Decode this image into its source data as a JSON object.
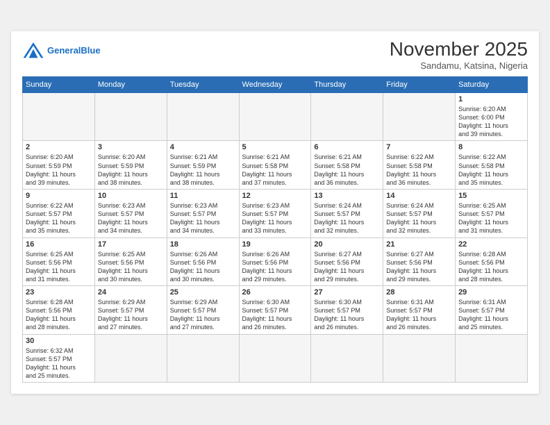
{
  "header": {
    "logo_general": "General",
    "logo_blue": "Blue",
    "month": "November 2025",
    "location": "Sandamu, Katsina, Nigeria"
  },
  "weekdays": [
    "Sunday",
    "Monday",
    "Tuesday",
    "Wednesday",
    "Thursday",
    "Friday",
    "Saturday"
  ],
  "weeks": [
    [
      {
        "day": "",
        "info": ""
      },
      {
        "day": "",
        "info": ""
      },
      {
        "day": "",
        "info": ""
      },
      {
        "day": "",
        "info": ""
      },
      {
        "day": "",
        "info": ""
      },
      {
        "day": "",
        "info": ""
      },
      {
        "day": "1",
        "info": "Sunrise: 6:20 AM\nSunset: 6:00 PM\nDaylight: 11 hours\nand 39 minutes."
      }
    ],
    [
      {
        "day": "2",
        "info": "Sunrise: 6:20 AM\nSunset: 5:59 PM\nDaylight: 11 hours\nand 39 minutes."
      },
      {
        "day": "3",
        "info": "Sunrise: 6:20 AM\nSunset: 5:59 PM\nDaylight: 11 hours\nand 38 minutes."
      },
      {
        "day": "4",
        "info": "Sunrise: 6:21 AM\nSunset: 5:59 PM\nDaylight: 11 hours\nand 38 minutes."
      },
      {
        "day": "5",
        "info": "Sunrise: 6:21 AM\nSunset: 5:58 PM\nDaylight: 11 hours\nand 37 minutes."
      },
      {
        "day": "6",
        "info": "Sunrise: 6:21 AM\nSunset: 5:58 PM\nDaylight: 11 hours\nand 36 minutes."
      },
      {
        "day": "7",
        "info": "Sunrise: 6:22 AM\nSunset: 5:58 PM\nDaylight: 11 hours\nand 36 minutes."
      },
      {
        "day": "8",
        "info": "Sunrise: 6:22 AM\nSunset: 5:58 PM\nDaylight: 11 hours\nand 35 minutes."
      }
    ],
    [
      {
        "day": "9",
        "info": "Sunrise: 6:22 AM\nSunset: 5:57 PM\nDaylight: 11 hours\nand 35 minutes."
      },
      {
        "day": "10",
        "info": "Sunrise: 6:23 AM\nSunset: 5:57 PM\nDaylight: 11 hours\nand 34 minutes."
      },
      {
        "day": "11",
        "info": "Sunrise: 6:23 AM\nSunset: 5:57 PM\nDaylight: 11 hours\nand 34 minutes."
      },
      {
        "day": "12",
        "info": "Sunrise: 6:23 AM\nSunset: 5:57 PM\nDaylight: 11 hours\nand 33 minutes."
      },
      {
        "day": "13",
        "info": "Sunrise: 6:24 AM\nSunset: 5:57 PM\nDaylight: 11 hours\nand 32 minutes."
      },
      {
        "day": "14",
        "info": "Sunrise: 6:24 AM\nSunset: 5:57 PM\nDaylight: 11 hours\nand 32 minutes."
      },
      {
        "day": "15",
        "info": "Sunrise: 6:25 AM\nSunset: 5:57 PM\nDaylight: 11 hours\nand 31 minutes."
      }
    ],
    [
      {
        "day": "16",
        "info": "Sunrise: 6:25 AM\nSunset: 5:56 PM\nDaylight: 11 hours\nand 31 minutes."
      },
      {
        "day": "17",
        "info": "Sunrise: 6:25 AM\nSunset: 5:56 PM\nDaylight: 11 hours\nand 30 minutes."
      },
      {
        "day": "18",
        "info": "Sunrise: 6:26 AM\nSunset: 5:56 PM\nDaylight: 11 hours\nand 30 minutes."
      },
      {
        "day": "19",
        "info": "Sunrise: 6:26 AM\nSunset: 5:56 PM\nDaylight: 11 hours\nand 29 minutes."
      },
      {
        "day": "20",
        "info": "Sunrise: 6:27 AM\nSunset: 5:56 PM\nDaylight: 11 hours\nand 29 minutes."
      },
      {
        "day": "21",
        "info": "Sunrise: 6:27 AM\nSunset: 5:56 PM\nDaylight: 11 hours\nand 29 minutes."
      },
      {
        "day": "22",
        "info": "Sunrise: 6:28 AM\nSunset: 5:56 PM\nDaylight: 11 hours\nand 28 minutes."
      }
    ],
    [
      {
        "day": "23",
        "info": "Sunrise: 6:28 AM\nSunset: 5:56 PM\nDaylight: 11 hours\nand 28 minutes."
      },
      {
        "day": "24",
        "info": "Sunrise: 6:29 AM\nSunset: 5:57 PM\nDaylight: 11 hours\nand 27 minutes."
      },
      {
        "day": "25",
        "info": "Sunrise: 6:29 AM\nSunset: 5:57 PM\nDaylight: 11 hours\nand 27 minutes."
      },
      {
        "day": "26",
        "info": "Sunrise: 6:30 AM\nSunset: 5:57 PM\nDaylight: 11 hours\nand 26 minutes."
      },
      {
        "day": "27",
        "info": "Sunrise: 6:30 AM\nSunset: 5:57 PM\nDaylight: 11 hours\nand 26 minutes."
      },
      {
        "day": "28",
        "info": "Sunrise: 6:31 AM\nSunset: 5:57 PM\nDaylight: 11 hours\nand 26 minutes."
      },
      {
        "day": "29",
        "info": "Sunrise: 6:31 AM\nSunset: 5:57 PM\nDaylight: 11 hours\nand 25 minutes."
      }
    ],
    [
      {
        "day": "30",
        "info": "Sunrise: 6:32 AM\nSunset: 5:57 PM\nDaylight: 11 hours\nand 25 minutes."
      },
      {
        "day": "",
        "info": ""
      },
      {
        "day": "",
        "info": ""
      },
      {
        "day": "",
        "info": ""
      },
      {
        "day": "",
        "info": ""
      },
      {
        "day": "",
        "info": ""
      },
      {
        "day": "",
        "info": ""
      }
    ]
  ]
}
